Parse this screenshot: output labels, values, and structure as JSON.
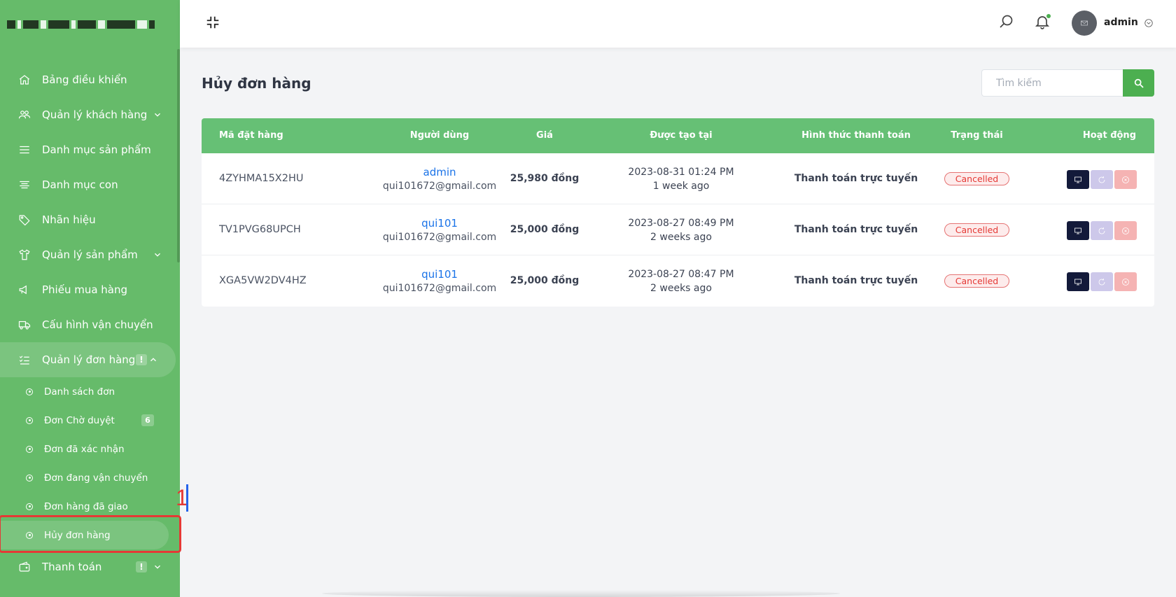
{
  "sidebar": {
    "items": [
      {
        "label": "Bảng điều khiển",
        "icon": "home-icon"
      },
      {
        "label": "Quản lý khách hàng",
        "icon": "users-icon",
        "has_chevron": true
      },
      {
        "label": "Danh mục sản phẩm",
        "icon": "menu-icon"
      },
      {
        "label": "Danh mục con",
        "icon": "align-icon"
      },
      {
        "label": "Nhãn hiệu",
        "icon": "tag-icon"
      },
      {
        "label": "Quản lý sản phẩm",
        "icon": "shirt-icon",
        "has_chevron": true
      },
      {
        "label": "Phiếu mua hàng",
        "icon": "megaphone-icon"
      },
      {
        "label": "Cấu hình vận chuyển",
        "icon": "truck-icon"
      },
      {
        "label": "Quản lý đơn hàng",
        "icon": "list-check-icon",
        "badge": "!",
        "expanded": true
      }
    ],
    "orders_sub": [
      {
        "label": "Danh sách đơn"
      },
      {
        "label": "Đơn Chờ duyệt",
        "count": "6"
      },
      {
        "label": "Đơn đã xác nhận"
      },
      {
        "label": "Đơn đang vận chuyển"
      },
      {
        "label": "Đơn hàng đã giao"
      },
      {
        "label": "Hủy đơn hàng",
        "active": true
      }
    ],
    "payment": {
      "label": "Thanh toán",
      "badge": "!",
      "icon": "wallet-icon"
    },
    "marker_number": "1"
  },
  "header": {
    "user_name": "admin"
  },
  "page": {
    "title": "Hủy đơn hàng",
    "search_placeholder": "Tìm kiếm"
  },
  "table": {
    "headers": {
      "code": "Mã đặt hàng",
      "user": "Người dùng",
      "price": "Giá",
      "created": "Được tạo tại",
      "payment": "Hình thức thanh toán",
      "status": "Trạng thái",
      "actions": "Hoạt động"
    },
    "rows": [
      {
        "code": "4ZYHMA15X2HU",
        "user": "admin",
        "email": "qui101672@gmail.com",
        "price": "25,980 đồng",
        "date": "2023-08-31 01:24 PM",
        "ago": "1 week ago",
        "payment": "Thanh toán trực tuyến",
        "status": "Cancelled"
      },
      {
        "code": "TV1PVG68UPCH",
        "user": "qui101",
        "email": "qui101672@gmail.com",
        "price": "25,000 đồng",
        "date": "2023-08-27 08:49 PM",
        "ago": "2 weeks ago",
        "payment": "Thanh toán trực tuyến",
        "status": "Cancelled"
      },
      {
        "code": "XGA5VW2DV4HZ",
        "user": "qui101",
        "email": "qui101672@gmail.com",
        "price": "25,000 đồng",
        "date": "2023-08-27 08:47 PM",
        "ago": "2 weeks ago",
        "payment": "Thanh toán trực tuyến",
        "status": "Cancelled"
      }
    ]
  },
  "colors": {
    "sidebar": "#66bb6a",
    "table_header": "#66c075",
    "accent": "#4caf50",
    "status_cancelled": "#e53935",
    "link": "#1a73e8"
  }
}
